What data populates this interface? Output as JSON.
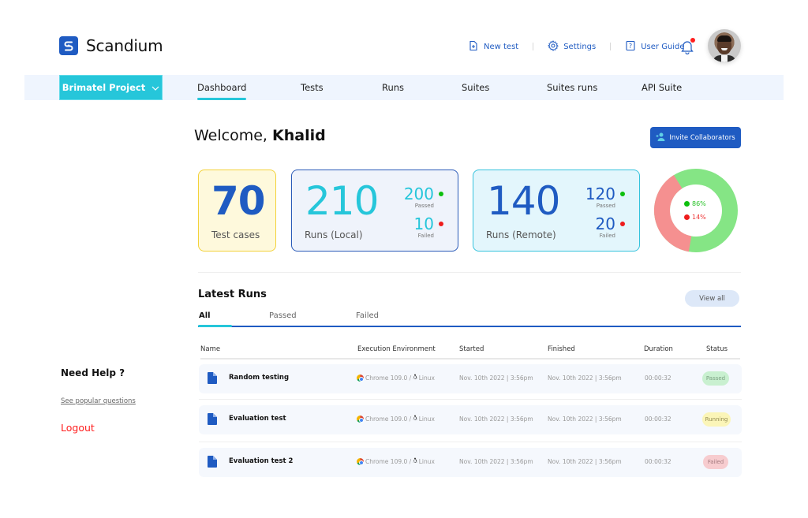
{
  "app": {
    "name": "Scandium"
  },
  "header": {
    "actions": [
      {
        "label": "New test",
        "icon": "new-file-icon"
      },
      {
        "label": "Settings",
        "icon": "gear-icon"
      },
      {
        "label": "User Guide",
        "icon": "help-book-icon"
      }
    ],
    "notifications_unread": true
  },
  "nav": {
    "project": "Brimatel Project",
    "tabs": [
      "Dashboard",
      "Tests",
      "Runs",
      "Suites",
      "Suites runs",
      "API Suite"
    ],
    "active_tab": "Dashboard"
  },
  "welcome": {
    "greeting": "Welcome,",
    "user": "Khalid"
  },
  "invite_button": "Invite Collaborators",
  "stats": {
    "test_cases": {
      "value": "70",
      "label": "Test cases"
    },
    "runs_local": {
      "value": "210",
      "label": "Runs (Local)",
      "passed": "200",
      "passed_label": "Passed",
      "failed": "10",
      "failed_label": "Failed"
    },
    "runs_remote": {
      "value": "140",
      "label": "Runs (Remote)",
      "passed": "120",
      "passed_label": "Passed",
      "failed": "20",
      "failed_label": "Failed"
    }
  },
  "donut": {
    "passed_pct": "86%",
    "failed_pct": "14%",
    "colors": {
      "passed": "#85e585",
      "failed": "#f59090",
      "passed_dot": "#0dbf0d",
      "failed_dot": "#ee1c1c"
    }
  },
  "latest_runs": {
    "title": "Latest Runs",
    "view_all": "View all",
    "filters": [
      "All",
      "Passed",
      "Failed"
    ],
    "active_filter": "All",
    "columns": [
      "Name",
      "Execution Environment",
      "Started",
      "Finished",
      "Duration",
      "Status"
    ],
    "rows": [
      {
        "name": "Random testing",
        "browser": "Chrome 109.0 /",
        "os": "Linux",
        "started": "Nov. 10th 2022  |  3:56pm",
        "finished": "Nov. 10th 2022  |  3:56pm",
        "duration": "00:00:32",
        "status": "Passed"
      },
      {
        "name": "Evaluation test",
        "browser": "Chrome 109.0 /",
        "os": "Linux",
        "started": "Nov. 10th 2022  |  3:56pm",
        "finished": "Nov. 10th 2022  |  3:56pm",
        "duration": "00:00:32",
        "status": "Running"
      },
      {
        "name": "Evaluation test 2",
        "browser": "Chrome 109.0 /",
        "os": "Linux",
        "started": "Nov. 10th 2022  |  3:56pm",
        "finished": "Nov. 10th 2022  |  3:56pm",
        "duration": "00:00:32",
        "status": "Failed"
      }
    ]
  },
  "sidebar": {
    "help_title": "Need Help ?",
    "help_link": "See popular questions",
    "logout": "Logout"
  }
}
